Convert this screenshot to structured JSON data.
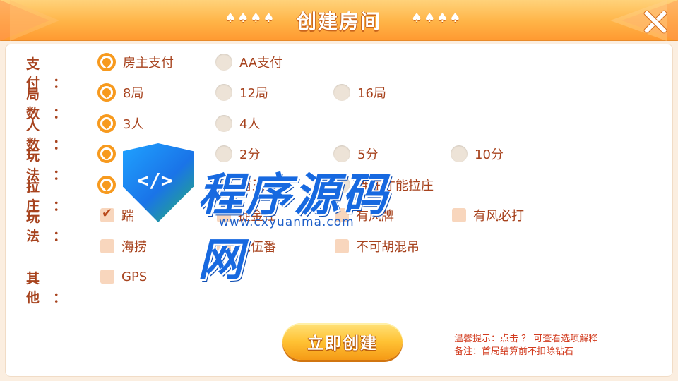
{
  "header": {
    "title": "创建房间",
    "deco_left": "♠♠♠♠",
    "deco_right": "♠♠♠♠",
    "close_icon": "close-x-icon"
  },
  "options": {
    "pay": {
      "label": "支付：",
      "choices": [
        {
          "label": "房主支付",
          "selected": true
        },
        {
          "label": "AA支付",
          "selected": false
        }
      ]
    },
    "rounds": {
      "label": "局数：",
      "choices": [
        {
          "label": "8局",
          "selected": true
        },
        {
          "label": "12局",
          "selected": false
        },
        {
          "label": "16局",
          "selected": false
        }
      ]
    },
    "players": {
      "label": "人数：",
      "choices": [
        {
          "label": "3人",
          "selected": true
        },
        {
          "label": "4人",
          "selected": false
        }
      ]
    },
    "mode_score": {
      "label": "玩法：",
      "choices": [
        {
          "label": "",
          "selected": true
        },
        {
          "label": "2分",
          "selected": false
        },
        {
          "label": "5分",
          "selected": false
        },
        {
          "label": "10分",
          "selected": false
        }
      ]
    },
    "banker": {
      "label": "拉庄：",
      "choices": [
        {
          "label": "",
          "selected": true
        },
        {
          "label": "有王拉庄",
          "selected": false
        },
        {
          "label": "连庄才能拉庄",
          "selected": false
        }
      ]
    },
    "rules": {
      "label": "玩法：",
      "choices": [
        {
          "label": "踹",
          "checked": true
        },
        {
          "label": "捉金任",
          "checked": false
        },
        {
          "label": "有风牌",
          "checked": false
        },
        {
          "label": "有风必打",
          "checked": false
        },
        {
          "label": "海捞",
          "checked": false
        },
        {
          "label": "龙伍番",
          "checked": false
        },
        {
          "label": "不可胡混吊",
          "checked": false
        }
      ]
    },
    "other": {
      "label": "其他：",
      "choices": [
        {
          "label": "GPS",
          "checked": false
        }
      ]
    }
  },
  "create_button": {
    "label": "立即创建"
  },
  "tips": {
    "line1": "温馨提示：点击 ？ 可查看选项解释",
    "line2": "备注：首局结算前不扣除钻石"
  },
  "watermark": {
    "name": "程序源码网",
    "url": "www.cxyuanma.com",
    "logo_text": "</>"
  },
  "colors": {
    "header_orange": "#ffb447",
    "label_brown": "#a7431e",
    "radio_active": "#f79a1e",
    "checkbox_fill": "#f8d6bd",
    "tip_red": "#d23b1e",
    "watermark_blue": "#1769e0"
  }
}
